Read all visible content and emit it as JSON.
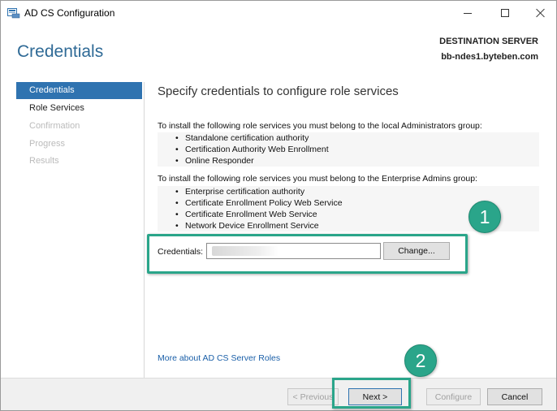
{
  "window": {
    "title": "AD CS Configuration",
    "icon": "server-manager-icon"
  },
  "header": {
    "page_title": "Credentials",
    "destination_label": "DESTINATION SERVER",
    "destination_value": "bb-ndes1.byteben.com"
  },
  "sidebar": {
    "items": [
      {
        "label": "Credentials",
        "state": "active"
      },
      {
        "label": "Role Services",
        "state": "normal"
      },
      {
        "label": "Confirmation",
        "state": "disabled"
      },
      {
        "label": "Progress",
        "state": "disabled"
      },
      {
        "label": "Results",
        "state": "disabled"
      }
    ]
  },
  "main": {
    "heading": "Specify credentials to configure role services",
    "local_admins_intro": "To install the following role services you must belong to the local Administrators group:",
    "local_admins_roles": [
      "Standalone certification authority",
      "Certification Authority Web Enrollment",
      "Online Responder"
    ],
    "enterprise_admins_intro": "To install the following role services you must belong to the Enterprise Admins group:",
    "enterprise_admins_roles": [
      "Enterprise certification authority",
      "Certificate Enrollment Policy Web Service",
      "Certificate Enrollment Web Service",
      "Network Device Enrollment Service"
    ],
    "credentials_label": "Credentials:",
    "credentials_value": "",
    "change_button": "Change...",
    "more_link": "More about AD CS Server Roles"
  },
  "annotations": {
    "step1": "1",
    "step2": "2",
    "color": "#2aa58a"
  },
  "footer": {
    "previous": "< Previous",
    "next": "Next >",
    "configure": "Configure",
    "cancel": "Cancel"
  },
  "colors": {
    "accent": "#2f73b0",
    "title": "#2f6a96",
    "link": "#1a5fa8"
  }
}
